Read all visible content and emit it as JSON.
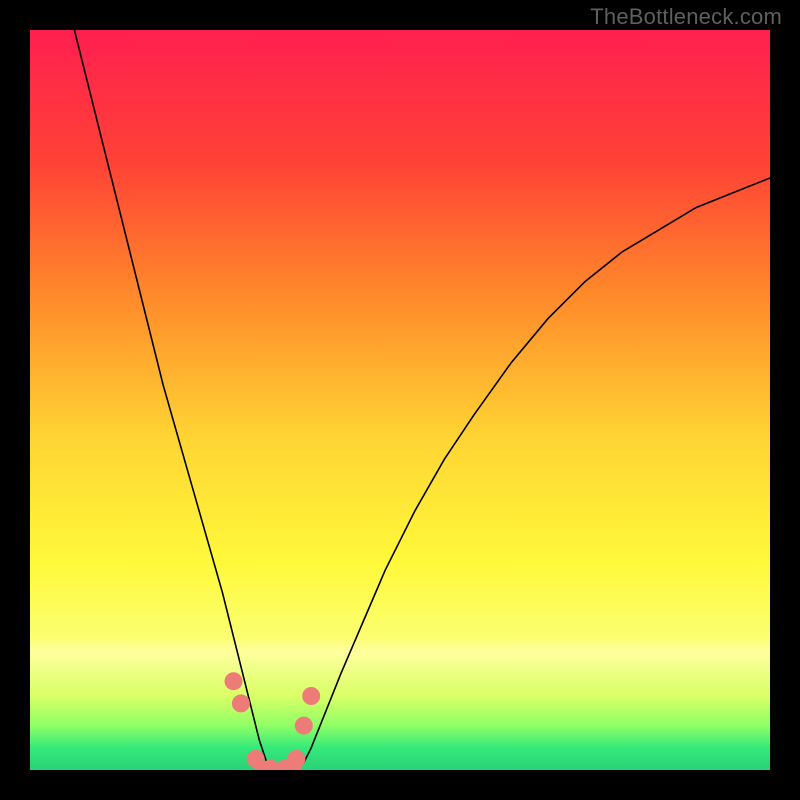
{
  "watermark": "TheBottleneck.com",
  "chart_data": {
    "type": "line",
    "title": "",
    "xlabel": "",
    "ylabel": "",
    "xlim": [
      0,
      100
    ],
    "ylim": [
      0,
      100
    ],
    "grid": false,
    "legend": false,
    "background_gradient": [
      {
        "pos": 0.0,
        "color": "#ff1f4f"
      },
      {
        "pos": 0.18,
        "color": "#ff4236"
      },
      {
        "pos": 0.36,
        "color": "#ff8a2a"
      },
      {
        "pos": 0.55,
        "color": "#ffd433"
      },
      {
        "pos": 0.72,
        "color": "#fff93a"
      },
      {
        "pos": 0.82,
        "color": "#fbff70"
      },
      {
        "pos": 0.84,
        "color": "#ffff9e"
      },
      {
        "pos": 0.9,
        "color": "#d9ff66"
      },
      {
        "pos": 0.94,
        "color": "#8fff66"
      },
      {
        "pos": 0.97,
        "color": "#35e97a"
      },
      {
        "pos": 1.0,
        "color": "#2ad178"
      }
    ],
    "series": [
      {
        "name": "curve",
        "color": "#000000",
        "width": 1.6,
        "x": [
          6,
          8,
          10,
          12,
          14,
          16,
          18,
          20,
          22,
          24,
          26,
          27,
          28,
          29,
          30,
          31,
          32,
          33,
          34,
          35,
          36,
          37,
          38,
          40,
          42,
          45,
          48,
          52,
          56,
          60,
          65,
          70,
          75,
          80,
          85,
          90,
          95,
          100
        ],
        "y": [
          100,
          92,
          84,
          76,
          68,
          60,
          52,
          45,
          38,
          31,
          24,
          20,
          16,
          12,
          8,
          4,
          1,
          0,
          0,
          0,
          0,
          1,
          3,
          8,
          13,
          20,
          27,
          35,
          42,
          48,
          55,
          61,
          66,
          70,
          73,
          76,
          78,
          80
        ]
      }
    ],
    "markers": {
      "name": "highlight-dots",
      "color": "#ed7c78",
      "radius": 9,
      "x": [
        27.5,
        28.5,
        30.5,
        32.5,
        34.5,
        36.0,
        37.0,
        38.0
      ],
      "y": [
        12,
        9,
        1.5,
        0.2,
        0.2,
        1.5,
        6,
        10
      ]
    },
    "valley_segment": {
      "name": "valley-underline",
      "color": "#ed7c78",
      "width": 10,
      "x": [
        31,
        36
      ],
      "y": [
        0.3,
        0.3
      ]
    }
  }
}
